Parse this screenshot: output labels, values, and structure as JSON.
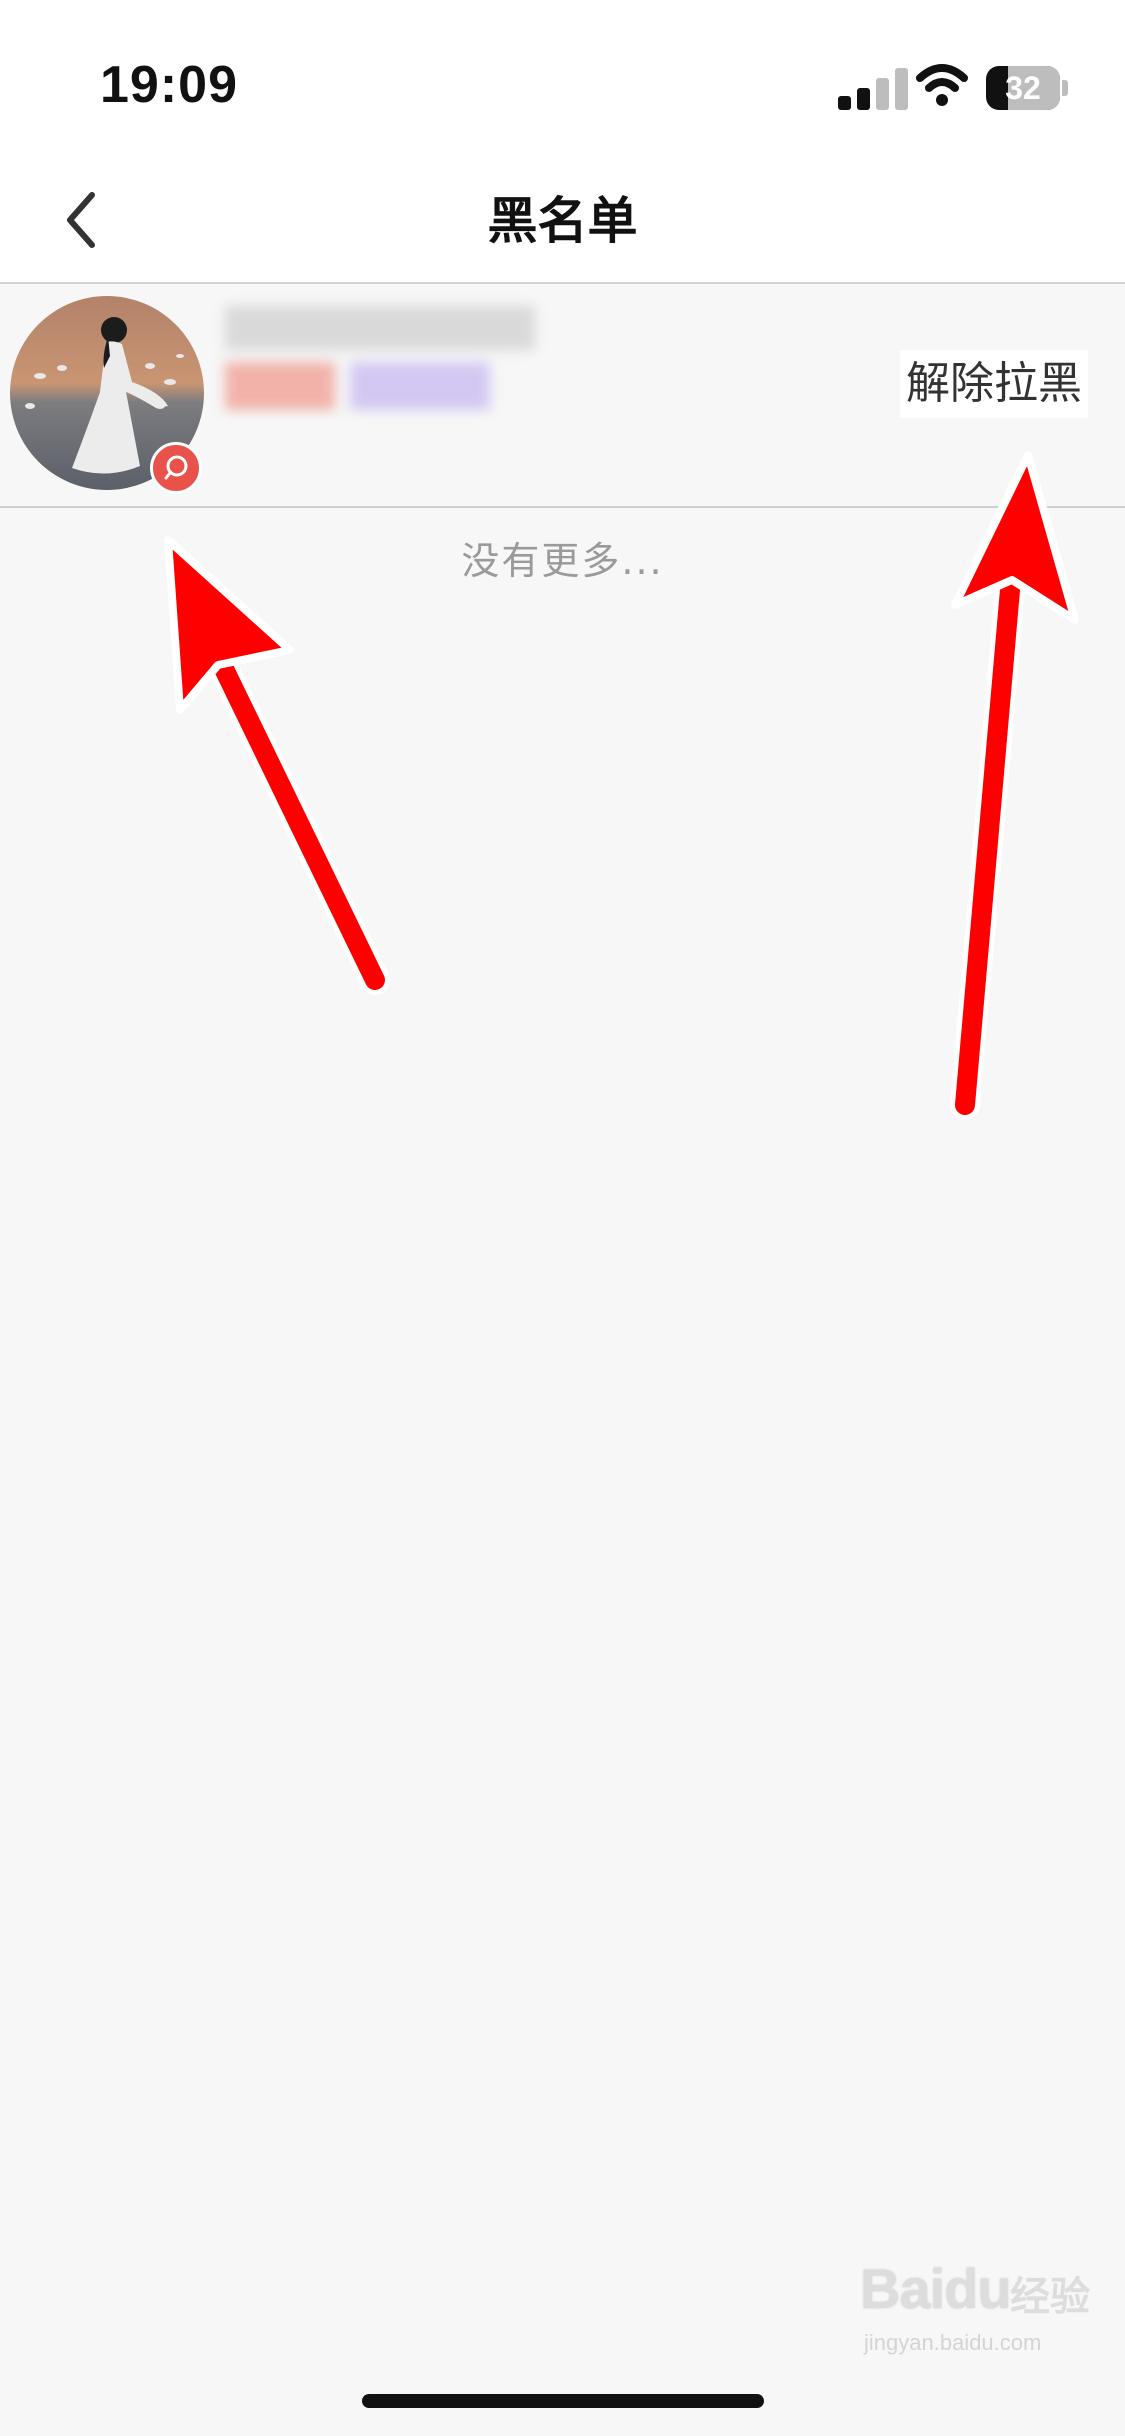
{
  "status_bar": {
    "time": "19:09",
    "battery_level": "32",
    "icons": [
      "signal-icon",
      "wifi-icon",
      "battery-icon"
    ]
  },
  "nav": {
    "title": "黑名单",
    "back_icon": "chevron-left-icon"
  },
  "blacklist": {
    "items": [
      {
        "avatar_icon": "avatar-photo",
        "badge_icon": "chat-badge-icon",
        "action_label": "解除拉黑"
      }
    ],
    "end_text": "没有更多..."
  },
  "watermark": {
    "brand": "Baidu",
    "brand_cn": "经验",
    "url": "jingyan.baidu.com"
  },
  "colors": {
    "annotation_arrow": "#ff0000",
    "badge": "#e8524a",
    "background": "#f7f7f7"
  }
}
